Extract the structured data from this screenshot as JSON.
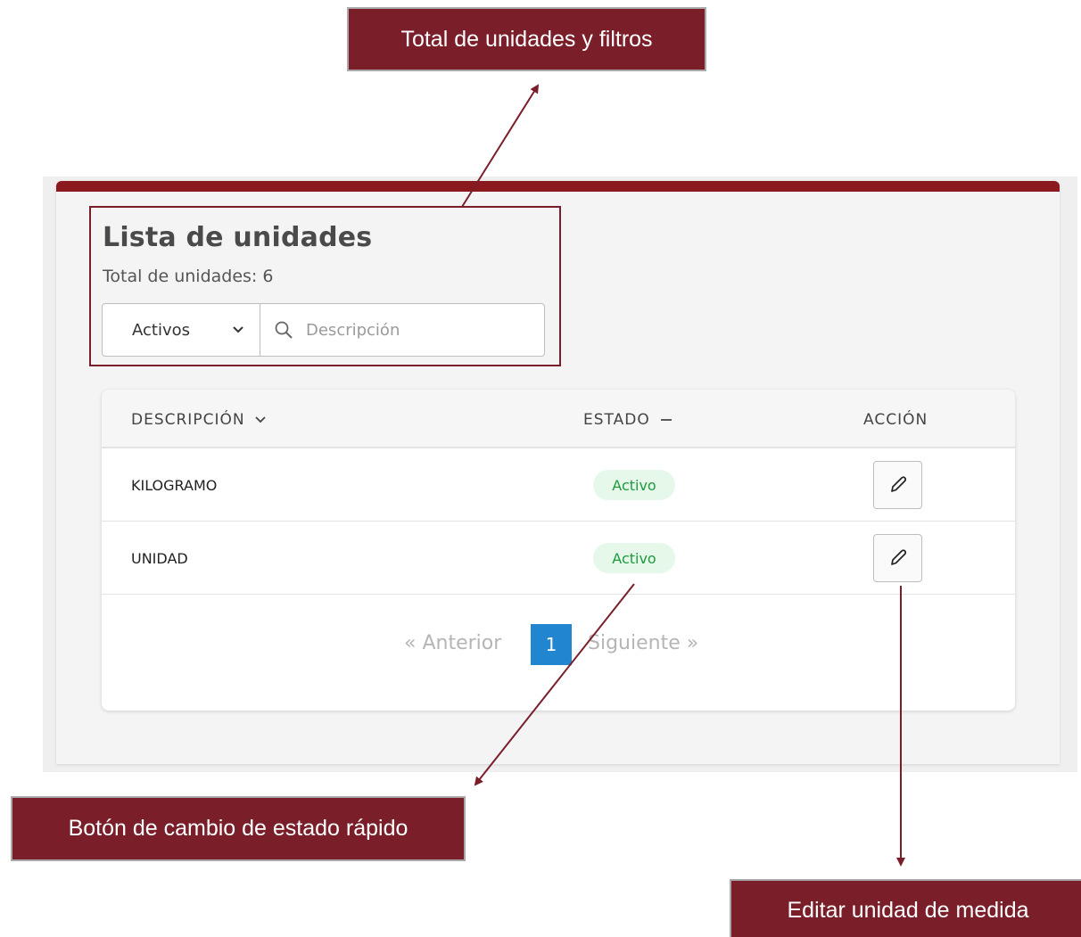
{
  "callouts": {
    "top": "Total de unidades y filtros",
    "left": "Botón de cambio de estado rápido",
    "right": "Editar unidad de medida"
  },
  "header": {
    "title": "Lista de unidades",
    "total_label": "Total de unidades: 6"
  },
  "filters": {
    "status_value": "Activos",
    "search_placeholder": "Descripción"
  },
  "table": {
    "columns": [
      "DESCRIPCIÓN",
      "ESTADO",
      "ACCIÓN"
    ],
    "rows": [
      {
        "description": "KILOGRAMO",
        "status": "Activo"
      },
      {
        "description": "UNIDAD",
        "status": "Activo"
      }
    ]
  },
  "pagination": {
    "prev_label": "«  Anterior",
    "current_page": "1",
    "next_label": "Siguiente  »"
  },
  "colors": {
    "accent": "#8b1a1f",
    "callout_bg": "#7a1f2a",
    "badge_bg": "#e5f8ea",
    "badge_text": "#1f9a3e",
    "page_active": "#2185d0"
  },
  "icons": [
    "chevron-down-icon",
    "search-icon",
    "minus-icon",
    "pencil-icon"
  ]
}
